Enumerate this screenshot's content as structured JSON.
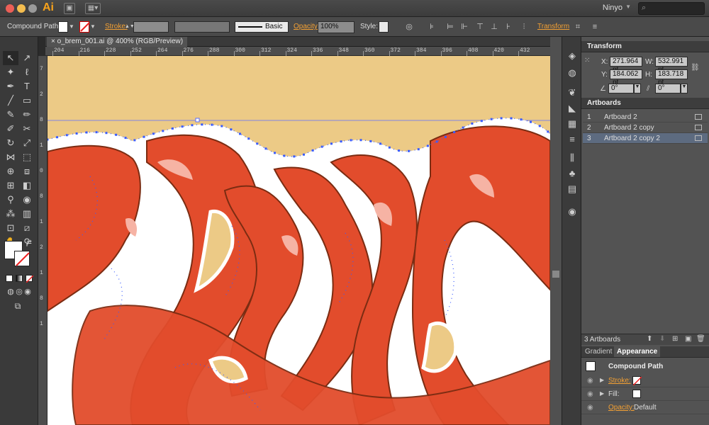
{
  "app": {
    "logo": "Ai",
    "workspace": "Ninyo",
    "search_placeholder": "",
    "colors": {
      "accent": "#f7a21b",
      "canvas_bg": "#ecca86",
      "art_red": "#e24c2c",
      "art_dark": "#7b2c12",
      "path_blue": "#3a5cff"
    }
  },
  "controlbar": {
    "selection_type": "Compound Path",
    "stroke_label": "Stroke:",
    "brush_label": "Basic",
    "opacity_label": "Opacity:",
    "opacity_value": "100%",
    "style_label": "Style:",
    "transform_label": "Transform"
  },
  "document": {
    "tab_title": "o_brem_001.ai @ 400% (RGB/Preview)"
  },
  "ruler": {
    "h_ticks": [
      "204",
      "216",
      "228",
      "252",
      "264",
      "276",
      "288",
      "300",
      "312",
      "324",
      "336",
      "348",
      "360",
      "372",
      "384",
      "396",
      "408",
      "420",
      "432"
    ],
    "v_ticks": [
      "7",
      "2",
      "8",
      "1",
      "0",
      "8",
      "1",
      "2",
      "1",
      "8",
      "1"
    ]
  },
  "transform": {
    "title": "Transform",
    "x_label": "X:",
    "x_value": "271.964 pt",
    "y_label": "Y:",
    "y_value": "184.062 pt",
    "w_label": "W:",
    "w_value": "532.991 pt",
    "h_label": "H:",
    "h_value": "183.718 pt",
    "rotate_value": "0°",
    "shear_value": "0°"
  },
  "artboards": {
    "title": "Artboards",
    "items": [
      {
        "num": "1",
        "name": "Artboard 2"
      },
      {
        "num": "2",
        "name": "Artboard 2 copy"
      },
      {
        "num": "3",
        "name": "Artboard 2 copy 2"
      }
    ],
    "count_label": "3 Artboards"
  },
  "appearance": {
    "tabs": [
      "Gradient",
      "Appearance"
    ],
    "object_label": "Compound Path",
    "stroke_label": "Stroke:",
    "fill_label": "Fill:",
    "opacity_label": "Opacity:",
    "opacity_value": "Default"
  }
}
